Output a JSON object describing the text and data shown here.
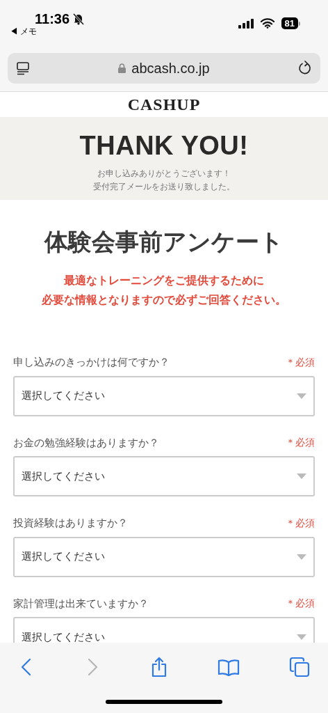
{
  "status_bar": {
    "time": "11:36",
    "silent": true,
    "back_app": "◀ メモ",
    "battery": "81"
  },
  "address_bar": {
    "url": "abcash.co.jp",
    "secure": true
  },
  "page": {
    "logo": "CASHUP",
    "banner": {
      "title": "THANK YOU!",
      "lines": [
        "お申し込みありがとうございます！",
        "受付完了メールをお送り致しました。"
      ]
    },
    "survey": {
      "title": "体験会事前アンケート",
      "notice": [
        "最適なトレーニングをご提供するために",
        "必要な情報となりますので必ずご回答ください。"
      ],
      "questions": [
        {
          "label": "申し込みのきっかけは何ですか？",
          "required": "＊必須",
          "value": "選択してください"
        },
        {
          "label": "お金の勉強経験はありますか？",
          "required": "＊必須",
          "value": "選択してください"
        },
        {
          "label": "投資経験はありますか？",
          "required": "＊必須",
          "value": "選択してください"
        },
        {
          "label": "家計管理は出来ていますか？",
          "required": "＊必須",
          "value": "選択してください"
        }
      ]
    }
  },
  "toolbar": [
    {
      "kind": "back",
      "disabled": false
    },
    {
      "kind": "forward",
      "disabled": true
    },
    {
      "kind": "share",
      "disabled": false
    },
    {
      "kind": "bookmarks",
      "disabled": false
    },
    {
      "kind": "tabs",
      "disabled": false
    }
  ]
}
